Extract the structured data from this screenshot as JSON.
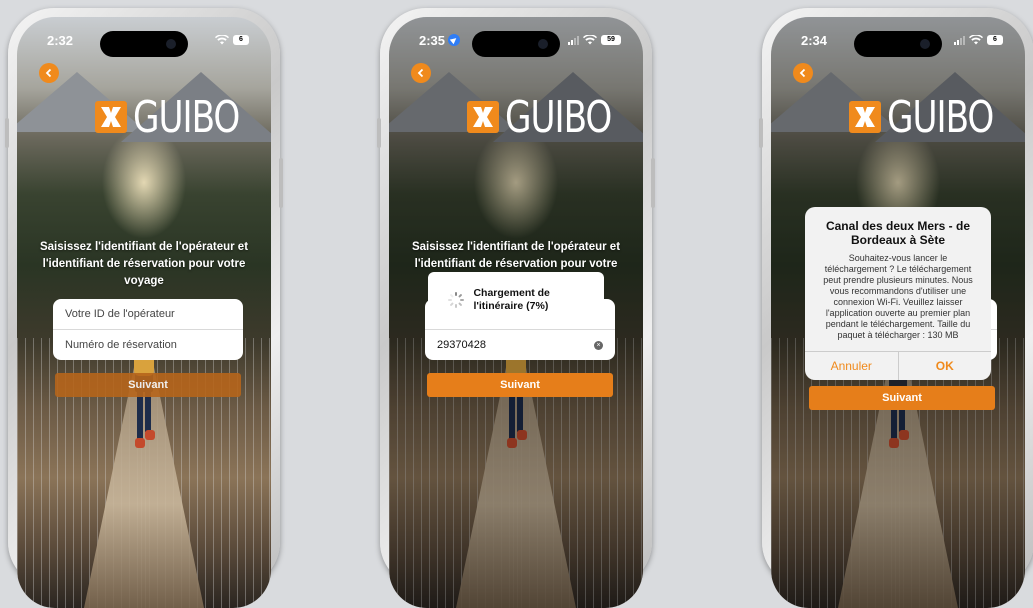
{
  "brand": {
    "name": "GUIBO",
    "accent": "#F08A1C"
  },
  "phones": [
    {
      "time": "2:32",
      "battery": "6",
      "prompt": "Saisissez l'identifiant de l'opérateur et l'identifiant de réservation pour votre voyage",
      "operator_placeholder": "Votre ID de l'opérateur",
      "reservation_placeholder": "Numéro de réservation",
      "next_label": "Suivant"
    },
    {
      "time": "2:35",
      "battery": "59",
      "prompt": "Saisissez l'identifiant de l'opérateur et l'identifiant de réservation pour votre voyage",
      "reservation_value": "29370428",
      "loading_text": "Chargement de l'itinéraire (7%)",
      "next_label": "Suivant"
    },
    {
      "time": "2:34",
      "battery": "6",
      "next_label": "Suivant",
      "alert": {
        "title": "Canal des deux Mers - de Bordeaux à Sète",
        "message": "Souhaitez-vous lancer le téléchargement ? Le téléchargement peut prendre plusieurs minutes. Nous vous recommandons d'utiliser une connexion Wi-Fi. Veuillez laisser l'application ouverte au premier plan pendant le téléchargement. Taille du paquet à télécharger : 130 MB",
        "cancel": "Annuler",
        "ok": "OK"
      }
    }
  ]
}
